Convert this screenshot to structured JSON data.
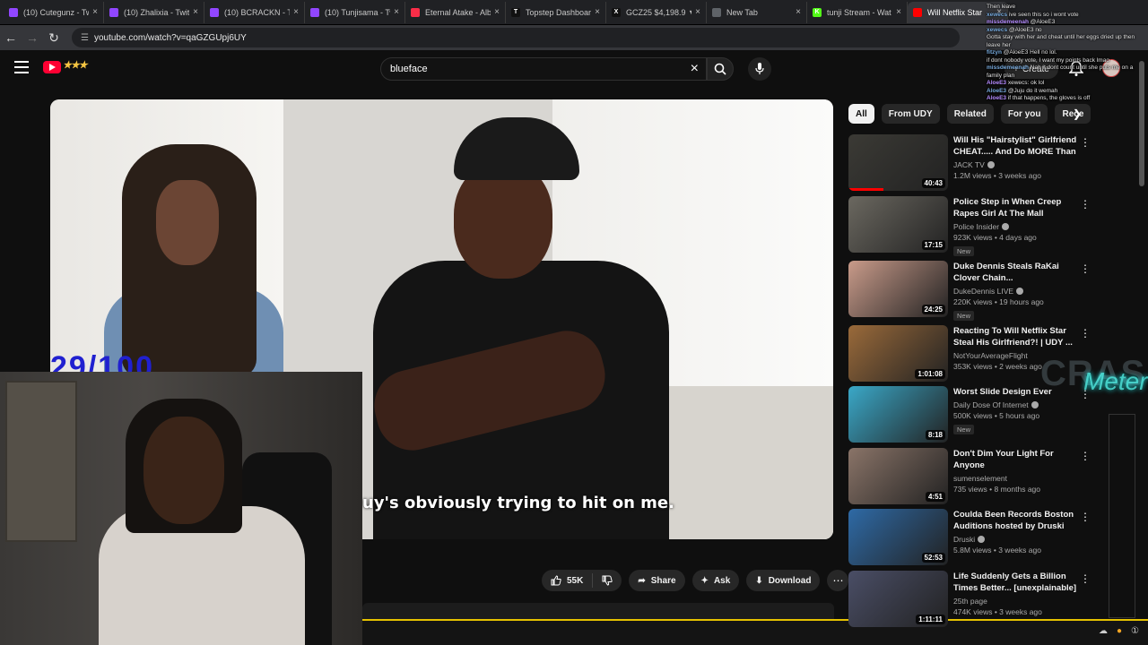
{
  "browser": {
    "tabs": [
      {
        "title": "(10) Cutegunz - Tw",
        "color": "#9146ff",
        "glyph": ""
      },
      {
        "title": "(10) Zhalixia - Twit",
        "color": "#9146ff",
        "glyph": ""
      },
      {
        "title": "(10) BCRACKN - Tw",
        "color": "#9146ff",
        "glyph": ""
      },
      {
        "title": "(10) Tunjisama - Tw",
        "color": "#9146ff",
        "glyph": ""
      },
      {
        "title": "Eternal Atake - Alb",
        "color": "#fa2d48",
        "glyph": ""
      },
      {
        "title": "Topstep Dashboard",
        "color": "#111111",
        "glyph": "T"
      },
      {
        "title": "GCZ25 $4,198.9 ▼",
        "color": "#111111",
        "glyph": "X"
      },
      {
        "title": "New Tab",
        "color": "#5f6368",
        "glyph": ""
      },
      {
        "title": "tunji Stream - Wat",
        "color": "#53fc18",
        "glyph": "K"
      },
      {
        "title": "Will Netflix Star",
        "color": "#ff0000",
        "glyph": ""
      }
    ],
    "url": "youtube.com/watch?v=qaGZGUpj6UY"
  },
  "header": {
    "search_query": "blueface",
    "create_label": "Create"
  },
  "video": {
    "watermark": "29/100",
    "caption": "uy's obviously trying to hit on me."
  },
  "actions": {
    "likes": "55K",
    "share": "Share",
    "ask": "Ask",
    "download": "Download"
  },
  "chips": [
    "All",
    "From UDY",
    "Related",
    "For you",
    "Rece"
  ],
  "recommendations": [
    {
      "title": "Will His \"Hairstylist\" Girlfriend CHEAT..... And Do MORE Than ...",
      "channel": "JACK TV",
      "verified": true,
      "views": "1.2M views • 3 weeks ago",
      "duration": "40:43",
      "is_new": false,
      "progress": 0.35,
      "thumb": "#3b3a35"
    },
    {
      "title": "Police Step in When Creep Rapes Girl At The Mall",
      "channel": "Police Insider",
      "verified": true,
      "views": "923K views • 4 days ago",
      "duration": "17:15",
      "is_new": true,
      "progress": 0,
      "thumb": "#6b6860"
    },
    {
      "title": "Duke Dennis Steals RaKai Clover Chain...",
      "channel": "DukeDennis LIVE",
      "verified": true,
      "views": "220K views • 19 hours ago",
      "duration": "24:25",
      "is_new": true,
      "progress": 0,
      "thumb": "#c99b8a"
    },
    {
      "title": "Reacting To Will Netflix Star Steal His Girlfriend?! | UDY ...",
      "channel": "NotYourAverageFlight",
      "verified": false,
      "views": "353K views • 2 weeks ago",
      "duration": "1:01:08",
      "is_new": false,
      "progress": 0,
      "thumb": "#9a6a3a"
    },
    {
      "title": "Worst Slide Design Ever",
      "channel": "Daily Dose Of Internet",
      "verified": true,
      "views": "500K views • 5 hours ago",
      "duration": "8:18",
      "is_new": true,
      "progress": 0,
      "thumb": "#3aa8c8"
    },
    {
      "title": "Don't Dim Your Light For Anyone",
      "channel": "sumenselement",
      "verified": false,
      "views": "735 views • 8 months ago",
      "duration": "4:51",
      "is_new": false,
      "progress": 0,
      "thumb": "#8a7468"
    },
    {
      "title": "Coulda Been Records Boston Auditions hosted by Druski",
      "channel": "Druski",
      "verified": true,
      "views": "5.8M views • 3 weeks ago",
      "duration": "52:53",
      "is_new": false,
      "progress": 0,
      "thumb": "#2e6aa6"
    },
    {
      "title": "Life Suddenly Gets a Billion Times Better... [unexplainable]",
      "channel": "25th page",
      "verified": false,
      "views": "474K views • 3 weeks ago",
      "duration": "1:11:11",
      "is_new": false,
      "progress": 0,
      "thumb": "#4a4e66"
    }
  ],
  "chat": [
    {
      "user": "",
      "msg": "Then leave"
    },
    {
      "user": "xewecs",
      "msg": "ive seen this so i wont vote"
    },
    {
      "user": "missdemeenah",
      "msg": "@AloeE3"
    },
    {
      "user": "xewecs",
      "msg": "@AloeE3 no"
    },
    {
      "user": "",
      "msg": "Gotta stay with her and cheat until her eggs dried up then leave her"
    },
    {
      "user": "fitzyn",
      "msg": "@AloeE3 Hell no lol."
    },
    {
      "user": "",
      "msg": "if dont nobody vote, I want my points back lmao"
    },
    {
      "user": "missdemeenah",
      "msg": "Nah it dont count until she puts me on a family plan"
    },
    {
      "user": "AloeE3",
      "msg": "xewecs: ok lol"
    },
    {
      "user": "AloeE3",
      "msg": "@Juju do it wemah"
    },
    {
      "user": "AloeE3",
      "msg": "if that happens, the gloves is off"
    }
  ],
  "overlay": {
    "crash": "CRASH",
    "meter": "Meter"
  }
}
